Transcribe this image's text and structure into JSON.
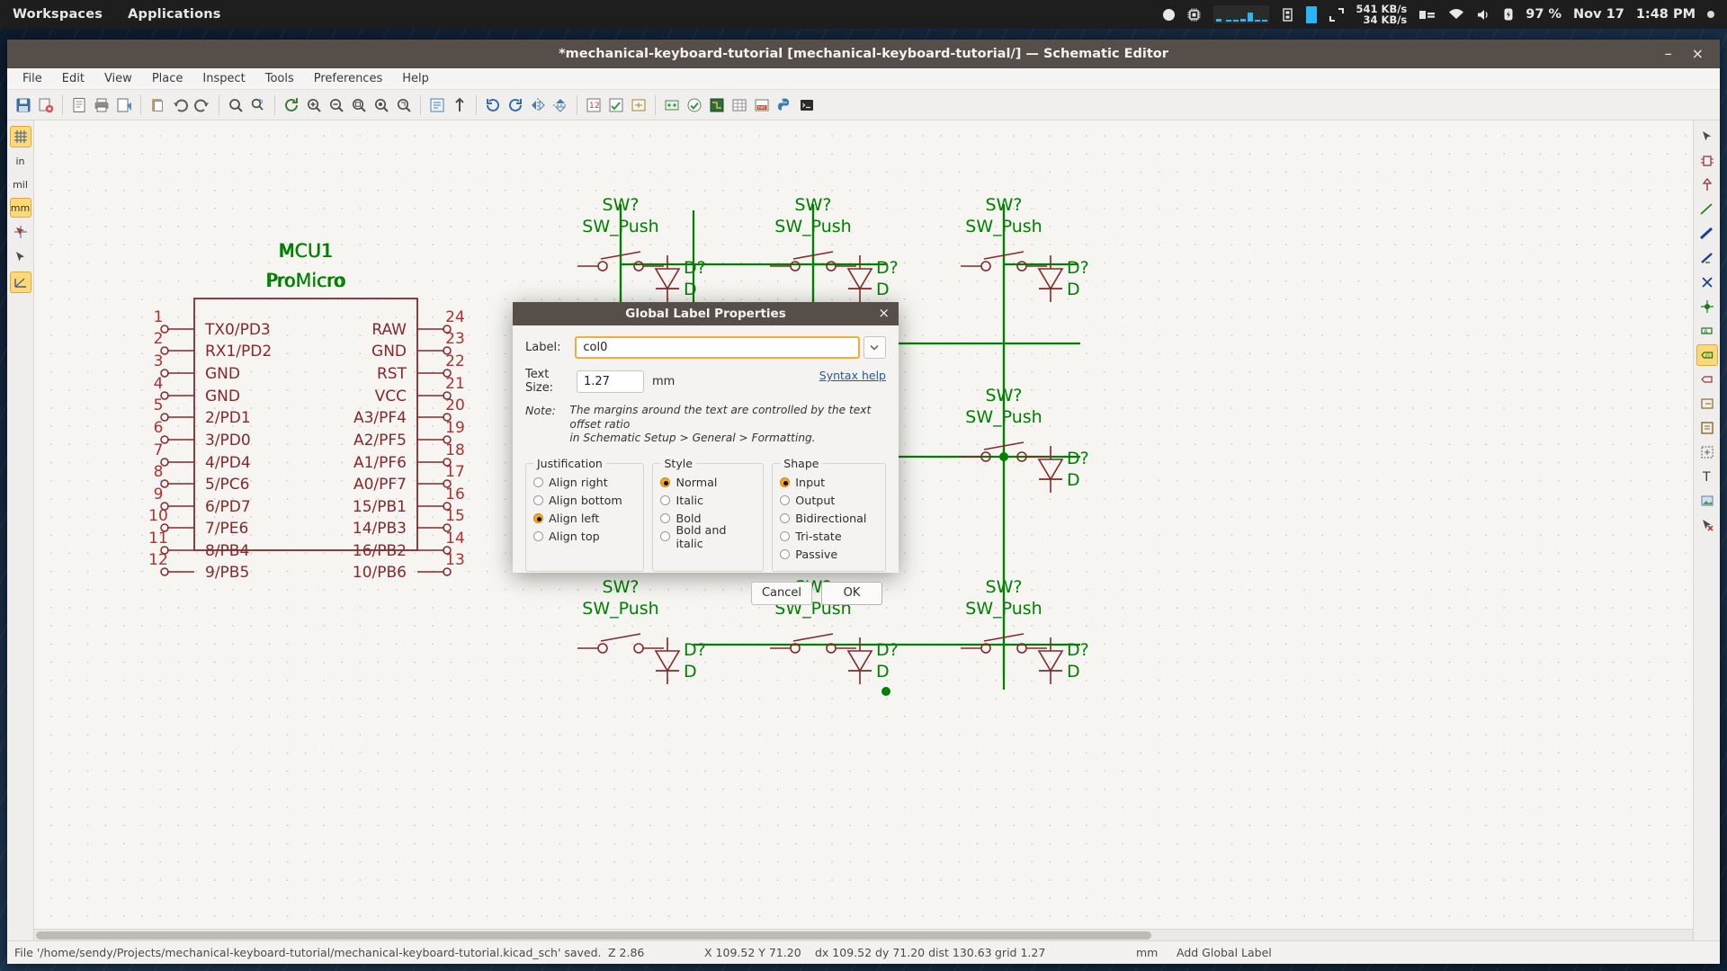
{
  "os_panel": {
    "left_items": [
      "Workspaces",
      "Applications"
    ],
    "net_down": "541 KB/s",
    "net_up": "34 KB/s",
    "battery": "97 %",
    "date": "Nov 17",
    "time": "1:48 PM",
    "icons": [
      "record-dot-icon",
      "cpu-icon",
      "cpu-graph-icon",
      "memory-icon",
      "memory-block-icon",
      "resize-icon",
      "keyboard-icon",
      "wifi-icon",
      "volume-icon",
      "battery-icon",
      "notification-dot-icon"
    ]
  },
  "window": {
    "title": "*mechanical-keyboard-tutorial [mechanical-keyboard-tutorial/] — Schematic Editor",
    "minimize": "–",
    "close": "×"
  },
  "menubar": {
    "items": [
      "File",
      "Edit",
      "View",
      "Place",
      "Inspect",
      "Tools",
      "Preferences",
      "Help"
    ]
  },
  "toolbar": {
    "buttons": [
      "save-icon",
      "schematic-setup-icon",
      "sep",
      "page-settings-icon",
      "print-icon",
      "plot-icon",
      "sep",
      "paste-icon",
      "undo-icon",
      "redo-icon",
      "sep",
      "find-icon",
      "find-replace-icon",
      "sep",
      "refresh-icon",
      "zoom-in-icon",
      "zoom-out-icon",
      "zoom-fit-icon",
      "zoom-objects-icon",
      "zoom-area-icon",
      "sep",
      "hierarchy-icon",
      "leave-sheet-icon",
      "sep",
      "rotate-ccw-icon",
      "rotate-cw-icon",
      "mirror-h-icon",
      "mirror-v-icon",
      "sep",
      "annotate-icon",
      "erc-icon",
      "symbol-editor-icon",
      "sep",
      "footprint-assign-icon",
      "run-drc-icon",
      "pcb-editor-icon",
      "bom-icon",
      "netlist-icon",
      "python-icon",
      "script-icon"
    ]
  },
  "left_rail": {
    "units": [
      "in",
      "mil",
      "mm"
    ],
    "unit_selected": "mm",
    "icons": [
      "cursor-grid-icon",
      "pointer-icon",
      "angle-icon"
    ],
    "grid_icon": "grid-icon"
  },
  "right_rail": {
    "icons": [
      "arrow-select-icon",
      "symbol-place-icon",
      "power-place-icon",
      "wire-icon",
      "bus-icon",
      "wire-to-bus-icon",
      "no-connect-icon",
      "junction-icon",
      "net-label-icon",
      "global-label-icon",
      "hier-label-icon",
      "sheet-pin-icon",
      "hier-sheet-icon",
      "sheet-import-icon",
      "text-icon",
      "image-icon",
      "delete-icon"
    ],
    "selected_icon": "global-label-icon"
  },
  "canvas": {
    "mcu": {
      "reference": "MCU1",
      "value": "ProMicro",
      "left_pin_numbers": [
        "1",
        "2",
        "3",
        "4",
        "5",
        "6",
        "7",
        "8",
        "9",
        "10",
        "11",
        "12"
      ],
      "left_pin_names": [
        "TX0/PD3",
        "RX1/PD2",
        "GND",
        "GND",
        "2/PD1",
        "3/PD0",
        "4/PD4",
        "5/PC6",
        "6/PD7",
        "7/PE6",
        "8/PB4",
        "9/PB5"
      ],
      "right_pin_numbers": [
        "24",
        "23",
        "22",
        "21",
        "20",
        "19",
        "18",
        "17",
        "16",
        "15",
        "14",
        "13"
      ],
      "right_pin_names": [
        "RAW",
        "GND",
        "RST",
        "VCC",
        "A3/PF4",
        "A2/PF5",
        "A1/PF6",
        "A0/PF7",
        "15/PB1",
        "14/PB3",
        "16/PB2",
        "10/PB6"
      ]
    },
    "switch_ref": "SW?",
    "switch_value": "SW_Push",
    "diode_ref": "D?",
    "diode_value": "D"
  },
  "dialog": {
    "title": "Global Label Properties",
    "close": "×",
    "label_field_label": "Label:",
    "label_value": "col0",
    "text_size_label": "Text Size:",
    "text_size_value": "1.27",
    "text_size_unit": "mm",
    "syntax_help": "Syntax help",
    "note_label": "Note:",
    "note_line1": "The margins around the text are controlled by the text offset ratio",
    "note_line2": "in Schematic Setup > General > Formatting.",
    "justification": {
      "legend": "Justification",
      "options": [
        "Align right",
        "Align bottom",
        "Align left",
        "Align top"
      ],
      "selected": "Align left"
    },
    "style": {
      "legend": "Style",
      "options": [
        "Normal",
        "Italic",
        "Bold",
        "Bold and italic"
      ],
      "selected": "Normal"
    },
    "shape": {
      "legend": "Shape",
      "options": [
        "Input",
        "Output",
        "Bidirectional",
        "Tri-state",
        "Passive"
      ],
      "selected": "Input"
    },
    "cancel": "Cancel",
    "ok": "OK"
  },
  "statusbar": {
    "file_message": "File '/home/sendy/Projects/mechanical-keyboard-tutorial/mechanical-keyboard-tutorial.kicad_sch' saved.",
    "zoom": "Z 2.86",
    "coords": "X 109.52  Y 71.20",
    "delta": "dx 109.52  dy 71.20  dist 130.63",
    "grid": "grid 1.27",
    "units": "mm",
    "tool": "Add Global Label"
  },
  "colors": {
    "accent": "#f5a623",
    "wire_green": "#008000",
    "symbol_red": "#84282c",
    "text_green": "#008000",
    "dialog_title_bg": "#564e49"
  }
}
